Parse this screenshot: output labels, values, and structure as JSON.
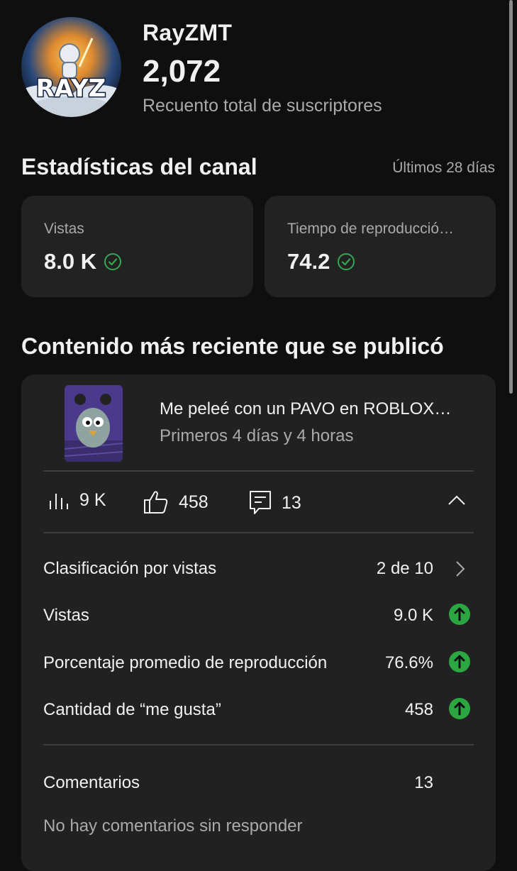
{
  "channel": {
    "name": "RayZMT",
    "subscriber_count": "2,072",
    "subscriber_label": "Recuento total de suscriptores",
    "avatar_text": "RAYZ"
  },
  "stats": {
    "title": "Estadísticas del canal",
    "period": "Últimos 28 días",
    "cards": [
      {
        "label": "Vistas",
        "value": "8.0 K"
      },
      {
        "label": "Tiempo de reproducció…",
        "value": "74.2"
      }
    ]
  },
  "recent": {
    "title": "Contenido más reciente que se publicó",
    "video_title": "Me peleé con un PAVO en ROBLOX…",
    "video_period": "Primeros 4 días y 4 horas",
    "metrics": {
      "views": "9 K",
      "likes": "458",
      "comments": "13"
    },
    "rows": [
      {
        "label": "Clasificación por vistas",
        "value": "2 de 10",
        "icon": "chevron-right-icon"
      },
      {
        "label": "Vistas",
        "value": "9.0 K",
        "icon": "arrow-up-circle-icon"
      },
      {
        "label": "Porcentaje promedio de reproducción",
        "value": "76.6%",
        "icon": "arrow-up-circle-icon"
      },
      {
        "label": "Cantidad de “me gusta”",
        "value": "458",
        "icon": "arrow-up-circle-icon"
      }
    ],
    "comments": {
      "label": "Comentarios",
      "value": "13",
      "note": "No hay comentarios sin responder"
    }
  },
  "colors": {
    "background": "#0f0f0f",
    "card": "#222222",
    "positive": "#2ba640",
    "check": "#34a853"
  }
}
